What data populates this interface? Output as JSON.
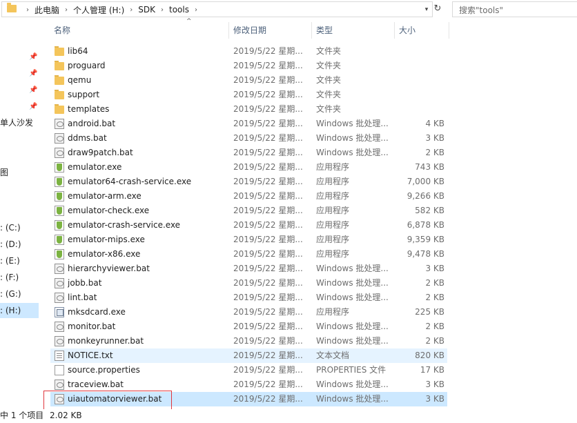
{
  "address": {
    "breadcrumbs": [
      "此电脑",
      "个人管理 (H:)",
      "SDK",
      "tools"
    ]
  },
  "search": {
    "placeholder": "搜索\"tools\""
  },
  "nav": {
    "items": [
      {
        "label": "",
        "pinned": true
      },
      {
        "label": "",
        "pinned": true
      },
      {
        "label": "",
        "pinned": true
      },
      {
        "label": "",
        "pinned": true
      },
      {
        "label": "单人沙发",
        "pinned": false
      },
      {
        "label": "",
        "pinned": false
      },
      {
        "label": "图",
        "pinned": false
      },
      {
        "label": "",
        "pinned": false
      },
      {
        "label": "",
        "pinned": false
      },
      {
        "label": ": (C:)",
        "pinned": false
      },
      {
        "label": ": (D:)",
        "pinned": false
      },
      {
        "label": ": (E:)",
        "pinned": false
      },
      {
        "label": ": (F:)",
        "pinned": false
      },
      {
        "label": ": (G:)",
        "pinned": false
      },
      {
        "label": ": (H:)",
        "pinned": false,
        "selected": true
      }
    ]
  },
  "columns": {
    "name": "名称",
    "date": "修改日期",
    "type": "类型",
    "size": "大小"
  },
  "files": [
    {
      "name": "lib64",
      "date": "2019/5/22 星期...",
      "type": "文件夹",
      "size": "",
      "icon": "folder-icon"
    },
    {
      "name": "proguard",
      "date": "2019/5/22 星期...",
      "type": "文件夹",
      "size": "",
      "icon": "folder-icon"
    },
    {
      "name": "qemu",
      "date": "2019/5/22 星期...",
      "type": "文件夹",
      "size": "",
      "icon": "folder-icon"
    },
    {
      "name": "support",
      "date": "2019/5/22 星期...",
      "type": "文件夹",
      "size": "",
      "icon": "folder-icon"
    },
    {
      "name": "templates",
      "date": "2019/5/22 星期...",
      "type": "文件夹",
      "size": "",
      "icon": "folder-icon"
    },
    {
      "name": "android.bat",
      "date": "2019/5/22 星期...",
      "type": "Windows 批处理...",
      "size": "4 KB",
      "icon": "batch-file-icon"
    },
    {
      "name": "ddms.bat",
      "date": "2019/5/22 星期...",
      "type": "Windows 批处理...",
      "size": "3 KB",
      "icon": "batch-file-icon"
    },
    {
      "name": "draw9patch.bat",
      "date": "2019/5/22 星期...",
      "type": "Windows 批处理...",
      "size": "2 KB",
      "icon": "batch-file-icon"
    },
    {
      "name": "emulator.exe",
      "date": "2019/5/22 星期...",
      "type": "应用程序",
      "size": "743 KB",
      "icon": "android-exe-icon"
    },
    {
      "name": "emulator64-crash-service.exe",
      "date": "2019/5/22 星期...",
      "type": "应用程序",
      "size": "7,000 KB",
      "icon": "android-exe-icon"
    },
    {
      "name": "emulator-arm.exe",
      "date": "2019/5/22 星期...",
      "type": "应用程序",
      "size": "9,266 KB",
      "icon": "android-exe-icon"
    },
    {
      "name": "emulator-check.exe",
      "date": "2019/5/22 星期...",
      "type": "应用程序",
      "size": "582 KB",
      "icon": "android-exe-icon"
    },
    {
      "name": "emulator-crash-service.exe",
      "date": "2019/5/22 星期...",
      "type": "应用程序",
      "size": "6,878 KB",
      "icon": "android-exe-icon"
    },
    {
      "name": "emulator-mips.exe",
      "date": "2019/5/22 星期...",
      "type": "应用程序",
      "size": "9,359 KB",
      "icon": "android-exe-icon"
    },
    {
      "name": "emulator-x86.exe",
      "date": "2019/5/22 星期...",
      "type": "应用程序",
      "size": "9,478 KB",
      "icon": "android-exe-icon"
    },
    {
      "name": "hierarchyviewer.bat",
      "date": "2019/5/22 星期...",
      "type": "Windows 批处理...",
      "size": "3 KB",
      "icon": "batch-file-icon"
    },
    {
      "name": "jobb.bat",
      "date": "2019/5/22 星期...",
      "type": "Windows 批处理...",
      "size": "2 KB",
      "icon": "batch-file-icon"
    },
    {
      "name": "lint.bat",
      "date": "2019/5/22 星期...",
      "type": "Windows 批处理...",
      "size": "2 KB",
      "icon": "batch-file-icon"
    },
    {
      "name": "mksdcard.exe",
      "date": "2019/5/22 星期...",
      "type": "应用程序",
      "size": "225 KB",
      "icon": "application-icon"
    },
    {
      "name": "monitor.bat",
      "date": "2019/5/22 星期...",
      "type": "Windows 批处理...",
      "size": "2 KB",
      "icon": "batch-file-icon"
    },
    {
      "name": "monkeyrunner.bat",
      "date": "2019/5/22 星期...",
      "type": "Windows 批处理...",
      "size": "2 KB",
      "icon": "batch-file-icon"
    },
    {
      "name": "NOTICE.txt",
      "date": "2019/5/22 星期...",
      "type": "文本文档",
      "size": "820 KB",
      "icon": "text-file-icon",
      "state": "hover"
    },
    {
      "name": "source.properties",
      "date": "2019/5/22 星期...",
      "type": "PROPERTIES 文件",
      "size": "17 KB",
      "icon": "document-icon"
    },
    {
      "name": "traceview.bat",
      "date": "2019/5/22 星期...",
      "type": "Windows 批处理...",
      "size": "3 KB",
      "icon": "batch-file-icon"
    },
    {
      "name": "uiautomatorviewer.bat",
      "date": "2019/5/22 星期...",
      "type": "Windows 批处理...",
      "size": "3 KB",
      "icon": "batch-file-icon",
      "state": "selected"
    }
  ],
  "status": {
    "selection": "中 1 个项目",
    "size": "2.02 KB"
  },
  "colors": {
    "selected_row": "#cce8ff",
    "hover_row": "#e5f3ff",
    "header_text": "#4c607a",
    "annotation_box": "#e0353c",
    "folder": "#f4c55b"
  }
}
